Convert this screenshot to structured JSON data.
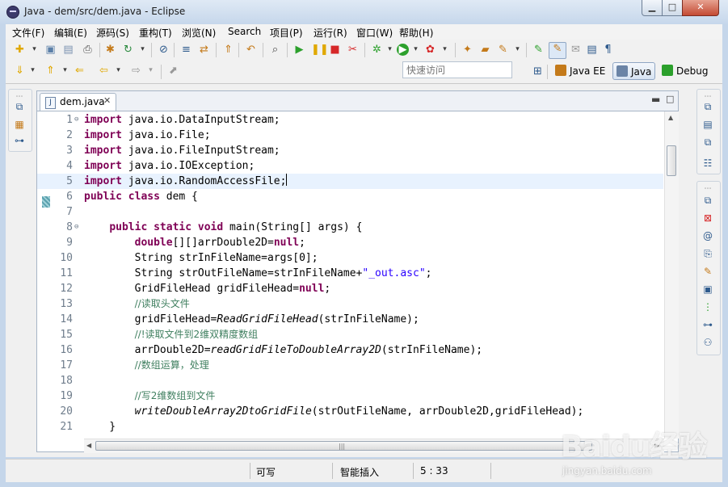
{
  "window": {
    "title": "Java - dem/src/dem.java - Eclipse"
  },
  "menu": [
    "文件(F)",
    "编辑(E)",
    "源码(S)",
    "重构(T)",
    "浏览(N)",
    "Search",
    "项目(P)",
    "运行(R)",
    "窗口(W)",
    "帮助(H)"
  ],
  "quick_access": {
    "placeholder": "快速访问"
  },
  "perspectives": [
    "Java EE",
    "Java",
    "Debug"
  ],
  "editor": {
    "tab_label": "dem.java",
    "lines": [
      {
        "n": "1",
        "fold": "⊖",
        "segments": [
          {
            "t": "import",
            "c": "kw"
          },
          {
            "t": " java.io.DataInputStream;"
          }
        ]
      },
      {
        "n": "2",
        "segments": [
          {
            "t": "import",
            "c": "kw"
          },
          {
            "t": " java.io.File;"
          }
        ]
      },
      {
        "n": "3",
        "segments": [
          {
            "t": "import",
            "c": "kw"
          },
          {
            "t": " java.io.FileInputStream;"
          }
        ]
      },
      {
        "n": "4",
        "segments": [
          {
            "t": "import",
            "c": "kw"
          },
          {
            "t": " java.io.IOException;"
          }
        ]
      },
      {
        "n": "5",
        "current": true,
        "segments": [
          {
            "t": "import",
            "c": "kw"
          },
          {
            "t": " java.io.RandomAccessFile;"
          },
          {
            "caret": true
          }
        ]
      },
      {
        "n": "6",
        "segments": [
          {
            "t": "public class",
            "c": "kw"
          },
          {
            "t": " dem {"
          }
        ]
      },
      {
        "n": "7",
        "segments": []
      },
      {
        "n": "8",
        "fold": "⊖",
        "segments": [
          {
            "t": "    "
          },
          {
            "t": "public static void",
            "c": "kw"
          },
          {
            "t": " main(String[] args) {"
          }
        ]
      },
      {
        "n": "9",
        "segments": [
          {
            "t": "        "
          },
          {
            "t": "double",
            "c": "kw"
          },
          {
            "t": "[][]arrDouble2D="
          },
          {
            "t": "null",
            "c": "kw"
          },
          {
            "t": ";"
          }
        ]
      },
      {
        "n": "10",
        "segments": [
          {
            "t": "        String strInFileName=args[0];"
          }
        ]
      },
      {
        "n": "11",
        "segments": [
          {
            "t": "        String strOutFileName=strInFileName+"
          },
          {
            "t": "\"_out.asc\"",
            "c": "str"
          },
          {
            "t": ";"
          }
        ]
      },
      {
        "n": "12",
        "segments": [
          {
            "t": "        GridFileHead gridFileHead="
          },
          {
            "t": "null",
            "c": "kw"
          },
          {
            "t": ";"
          }
        ]
      },
      {
        "n": "13",
        "segments": [
          {
            "t": "        "
          },
          {
            "t": "//读取头文件",
            "c": "cmt"
          }
        ]
      },
      {
        "n": "14",
        "segments": [
          {
            "t": "        gridFileHead="
          },
          {
            "t": "ReadGridFileHead",
            "c": "it"
          },
          {
            "t": "(strInFileName);"
          }
        ]
      },
      {
        "n": "15",
        "segments": [
          {
            "t": "        "
          },
          {
            "t": "//!读取文件到2维双精度数组",
            "c": "cmt"
          }
        ]
      },
      {
        "n": "16",
        "segments": [
          {
            "t": "        arrDouble2D="
          },
          {
            "t": "readGridFileToDoubleArray2D",
            "c": "it"
          },
          {
            "t": "(strInFileName);"
          }
        ]
      },
      {
        "n": "17",
        "segments": [
          {
            "t": "        "
          },
          {
            "t": "//数组运算，处理",
            "c": "cmt"
          }
        ]
      },
      {
        "n": "18",
        "segments": []
      },
      {
        "n": "19",
        "segments": [
          {
            "t": "        "
          },
          {
            "t": "//写2维数组到文件",
            "c": "cmt"
          }
        ]
      },
      {
        "n": "20",
        "segments": [
          {
            "t": "        "
          },
          {
            "t": "writeDoubleArray2DtoGridFile",
            "c": "it"
          },
          {
            "t": "(strOutFileName, arrDouble2D,gridFileHead);"
          }
        ]
      },
      {
        "n": "21",
        "segments": [
          {
            "t": "    }"
          }
        ]
      }
    ]
  },
  "status": {
    "writable": "可写",
    "insert_mode": "智能插入",
    "position": "5 : 33"
  },
  "watermark": {
    "logo": "Baidu经验",
    "url": "jingyan.baidu.com"
  }
}
